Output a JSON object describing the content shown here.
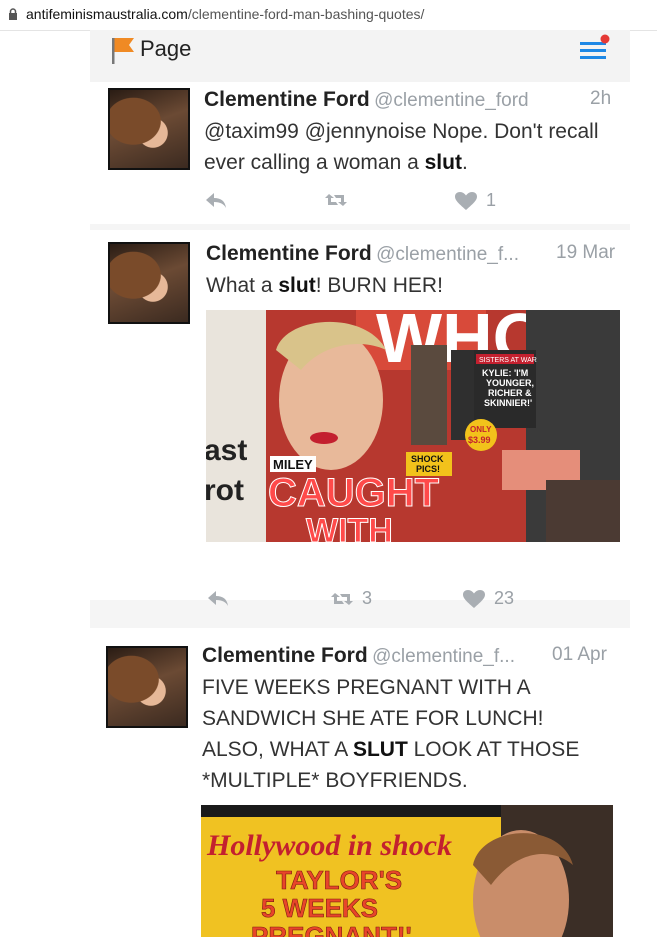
{
  "browser": {
    "url_domain": "antifeminismaustralia.com",
    "url_path": "/clementine-ford-man-bashing-quotes/"
  },
  "app": {
    "page_label": "Page"
  },
  "tweets": [
    {
      "name": "Clementine Ford",
      "handle": "@clementine_ford",
      "time": "2h",
      "text_before": "@taxim99 @jennynoise Nope. Don't recall ever calling a woman a ",
      "text_bold": "slut",
      "text_after": ".",
      "retweets": "",
      "likes": "1"
    },
    {
      "name": "Clementine Ford",
      "handle": "@clementine_f...",
      "time": "19 Mar",
      "text_before": "What a ",
      "text_bold": "slut",
      "text_after": "! BURN HER!",
      "retweets": "3",
      "likes": "23",
      "image": {
        "masthead": "WHO",
        "left_text": [
          "ast",
          "rot"
        ],
        "sticker_top": [
          "SISTERS AT WAR",
          "KYLIE: 'I'M",
          "YOUNGER,",
          "RICHER &",
          "SKINNIER!'"
        ],
        "price": [
          "ONLY",
          "$3.99"
        ],
        "shock": [
          "SHOCK",
          "PICS!"
        ],
        "miley": "MILEY",
        "headline": [
          "CAUGHT",
          "WITH"
        ]
      }
    },
    {
      "name": "Clementine Ford",
      "handle": "@clementine_f...",
      "time": "01 Apr",
      "text_lines": [
        "FIVE WEEKS PREGNANT WITH A",
        "SANDWICH SHE ATE FOR LUNCH!",
        "ALSO, WHAT A ",
        "SLUT",
        " LOOK AT THOSE",
        "*MULTIPLE* BOYFRIENDS."
      ],
      "image": {
        "headline": "Hollywood in shock",
        "subhead": [
          "TAYLOR'S",
          "5 WEEKS",
          "PREGNANT!'"
        ]
      }
    }
  ],
  "colors": {
    "flag": "#f08a24",
    "menu": "#1e88e5",
    "badge": "#e53935",
    "muted": "#9aa0a6"
  },
  "icons": [
    "lock-icon",
    "flag-icon",
    "menu-icon",
    "reply-icon",
    "retweet-icon",
    "heart-icon"
  ]
}
